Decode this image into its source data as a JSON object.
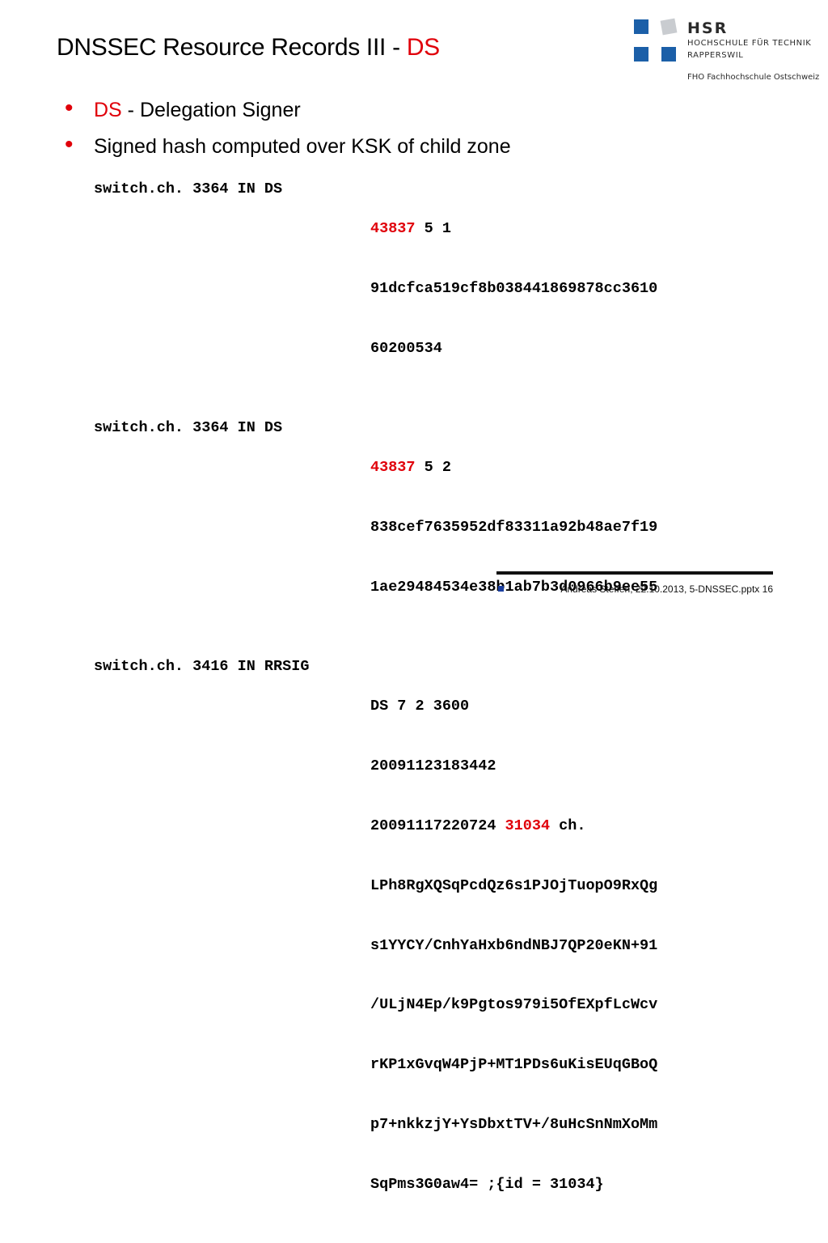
{
  "slide": {
    "title_main": "DNSSEC Resource Records III - ",
    "title_accent": "DS"
  },
  "logo": {
    "name": "HSR",
    "line1": "HOCHSCHULE FÜR TECHNIK",
    "line2": "RAPPERSWIL",
    "tagline": "FHO Fachhochschule Ostschweiz"
  },
  "bullets": [
    {
      "accent": "DS",
      "text": " - Delegation Signer"
    },
    {
      "accent": "",
      "text": "Signed hash computed over KSK of child zone"
    }
  ],
  "records": [
    {
      "owner": "switch.ch. 3364 IN DS",
      "key_tag": "43837",
      "after_tag": " 5 1",
      "lines": [
        "91dcfca519cf8b038441869878cc3610",
        "60200534"
      ]
    },
    {
      "owner": "switch.ch. 3364 IN DS",
      "key_tag": "43837",
      "after_tag": " 5 2",
      "lines": [
        "838cef7635952df83311a92b48ae7f19",
        "1ae29484534e38b1ab7b3d0966b9ee55"
      ]
    },
    {
      "owner": "switch.ch. 3416 IN RRSIG",
      "first_line": "DS 7 2 3600",
      "line2": "20091123183442",
      "sig_inception": "20091117220724 ",
      "sig_key_tag": "31034",
      "sig_signer": " ch.",
      "sig_lines": [
        "LPh8RgXQSqPcdQz6s1PJOjTuopO9RxQg",
        "s1YYCY/CnhYaHxb6ndNBJ7QP20eKN+91",
        "/ULjN4Ep/k9Pgtos979i5OfEXpfLcWcv",
        "rKP1xGvqW4PjP+MT1PDs6uKisEUqGBoQ",
        "p7+nkkzjY+YsDbxtTV+/8uHcSnNmXoMm",
        "SqPms3G0aw4= ;{id = 31034}"
      ]
    }
  ],
  "footer": {
    "text": "Andreas Steffen, 22.10.2013, 5-DNSSEC.pptx 16"
  },
  "colors": {
    "accent": "#e0000a",
    "brand_blue": "#1b5fa8"
  }
}
